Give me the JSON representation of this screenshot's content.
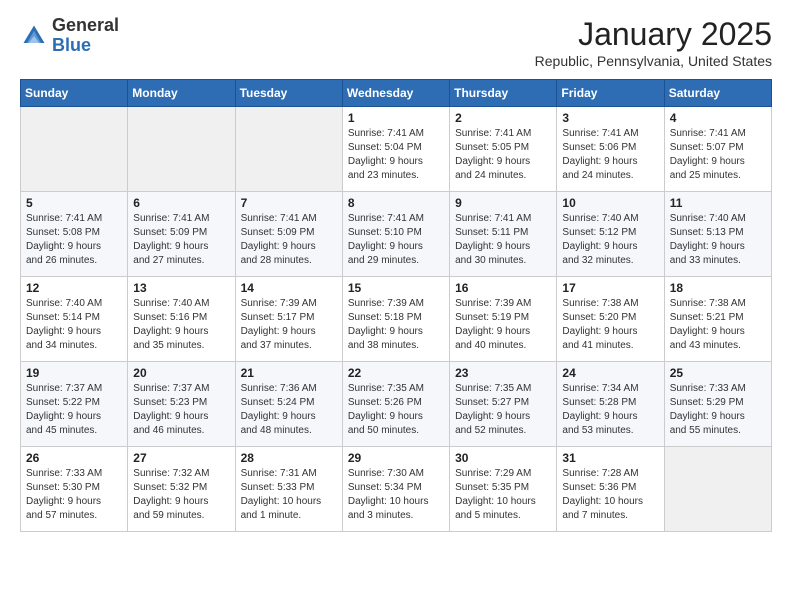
{
  "header": {
    "logo_general": "General",
    "logo_blue": "Blue",
    "month_title": "January 2025",
    "location": "Republic, Pennsylvania, United States"
  },
  "weekdays": [
    "Sunday",
    "Monday",
    "Tuesday",
    "Wednesday",
    "Thursday",
    "Friday",
    "Saturday"
  ],
  "weeks": [
    [
      {
        "day": "",
        "info": ""
      },
      {
        "day": "",
        "info": ""
      },
      {
        "day": "",
        "info": ""
      },
      {
        "day": "1",
        "info": "Sunrise: 7:41 AM\nSunset: 5:04 PM\nDaylight: 9 hours\nand 23 minutes."
      },
      {
        "day": "2",
        "info": "Sunrise: 7:41 AM\nSunset: 5:05 PM\nDaylight: 9 hours\nand 24 minutes."
      },
      {
        "day": "3",
        "info": "Sunrise: 7:41 AM\nSunset: 5:06 PM\nDaylight: 9 hours\nand 24 minutes."
      },
      {
        "day": "4",
        "info": "Sunrise: 7:41 AM\nSunset: 5:07 PM\nDaylight: 9 hours\nand 25 minutes."
      }
    ],
    [
      {
        "day": "5",
        "info": "Sunrise: 7:41 AM\nSunset: 5:08 PM\nDaylight: 9 hours\nand 26 minutes."
      },
      {
        "day": "6",
        "info": "Sunrise: 7:41 AM\nSunset: 5:09 PM\nDaylight: 9 hours\nand 27 minutes."
      },
      {
        "day": "7",
        "info": "Sunrise: 7:41 AM\nSunset: 5:09 PM\nDaylight: 9 hours\nand 28 minutes."
      },
      {
        "day": "8",
        "info": "Sunrise: 7:41 AM\nSunset: 5:10 PM\nDaylight: 9 hours\nand 29 minutes."
      },
      {
        "day": "9",
        "info": "Sunrise: 7:41 AM\nSunset: 5:11 PM\nDaylight: 9 hours\nand 30 minutes."
      },
      {
        "day": "10",
        "info": "Sunrise: 7:40 AM\nSunset: 5:12 PM\nDaylight: 9 hours\nand 32 minutes."
      },
      {
        "day": "11",
        "info": "Sunrise: 7:40 AM\nSunset: 5:13 PM\nDaylight: 9 hours\nand 33 minutes."
      }
    ],
    [
      {
        "day": "12",
        "info": "Sunrise: 7:40 AM\nSunset: 5:14 PM\nDaylight: 9 hours\nand 34 minutes."
      },
      {
        "day": "13",
        "info": "Sunrise: 7:40 AM\nSunset: 5:16 PM\nDaylight: 9 hours\nand 35 minutes."
      },
      {
        "day": "14",
        "info": "Sunrise: 7:39 AM\nSunset: 5:17 PM\nDaylight: 9 hours\nand 37 minutes."
      },
      {
        "day": "15",
        "info": "Sunrise: 7:39 AM\nSunset: 5:18 PM\nDaylight: 9 hours\nand 38 minutes."
      },
      {
        "day": "16",
        "info": "Sunrise: 7:39 AM\nSunset: 5:19 PM\nDaylight: 9 hours\nand 40 minutes."
      },
      {
        "day": "17",
        "info": "Sunrise: 7:38 AM\nSunset: 5:20 PM\nDaylight: 9 hours\nand 41 minutes."
      },
      {
        "day": "18",
        "info": "Sunrise: 7:38 AM\nSunset: 5:21 PM\nDaylight: 9 hours\nand 43 minutes."
      }
    ],
    [
      {
        "day": "19",
        "info": "Sunrise: 7:37 AM\nSunset: 5:22 PM\nDaylight: 9 hours\nand 45 minutes."
      },
      {
        "day": "20",
        "info": "Sunrise: 7:37 AM\nSunset: 5:23 PM\nDaylight: 9 hours\nand 46 minutes."
      },
      {
        "day": "21",
        "info": "Sunrise: 7:36 AM\nSunset: 5:24 PM\nDaylight: 9 hours\nand 48 minutes."
      },
      {
        "day": "22",
        "info": "Sunrise: 7:35 AM\nSunset: 5:26 PM\nDaylight: 9 hours\nand 50 minutes."
      },
      {
        "day": "23",
        "info": "Sunrise: 7:35 AM\nSunset: 5:27 PM\nDaylight: 9 hours\nand 52 minutes."
      },
      {
        "day": "24",
        "info": "Sunrise: 7:34 AM\nSunset: 5:28 PM\nDaylight: 9 hours\nand 53 minutes."
      },
      {
        "day": "25",
        "info": "Sunrise: 7:33 AM\nSunset: 5:29 PM\nDaylight: 9 hours\nand 55 minutes."
      }
    ],
    [
      {
        "day": "26",
        "info": "Sunrise: 7:33 AM\nSunset: 5:30 PM\nDaylight: 9 hours\nand 57 minutes."
      },
      {
        "day": "27",
        "info": "Sunrise: 7:32 AM\nSunset: 5:32 PM\nDaylight: 9 hours\nand 59 minutes."
      },
      {
        "day": "28",
        "info": "Sunrise: 7:31 AM\nSunset: 5:33 PM\nDaylight: 10 hours\nand 1 minute."
      },
      {
        "day": "29",
        "info": "Sunrise: 7:30 AM\nSunset: 5:34 PM\nDaylight: 10 hours\nand 3 minutes."
      },
      {
        "day": "30",
        "info": "Sunrise: 7:29 AM\nSunset: 5:35 PM\nDaylight: 10 hours\nand 5 minutes."
      },
      {
        "day": "31",
        "info": "Sunrise: 7:28 AM\nSunset: 5:36 PM\nDaylight: 10 hours\nand 7 minutes."
      },
      {
        "day": "",
        "info": ""
      }
    ]
  ]
}
